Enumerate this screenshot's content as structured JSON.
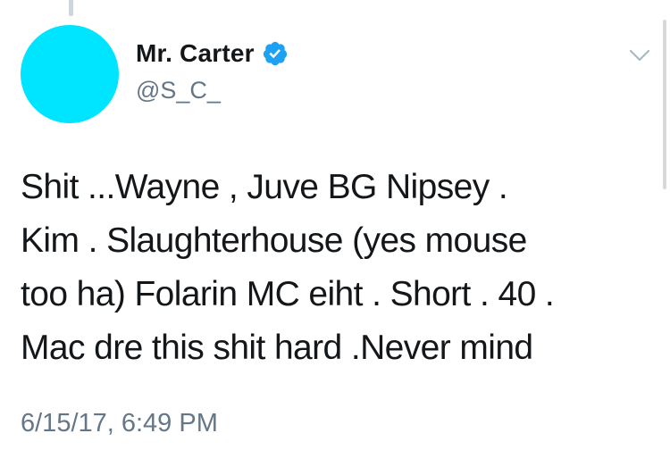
{
  "tweet": {
    "author": {
      "display_name": "Mr. Carter",
      "handle": "@S_C_",
      "verified": true
    },
    "text_lines": [
      "Shit ...Wayne , Juve BG Nipsey .",
      "Kim . Slaughterhouse (yes mouse",
      "too ha) Folarin MC eiht . Short . 40 .",
      "Mac dre this shit hard .Never mind"
    ],
    "timestamp": "6/15/17, 6:49 PM"
  },
  "icons": {
    "verified": "verified-badge-icon",
    "more": "chevron-down-icon"
  },
  "colors": {
    "avatar": "#00e5ff",
    "verified_blue": "#1da1f2",
    "text": "#14171a",
    "muted": "#657786"
  }
}
